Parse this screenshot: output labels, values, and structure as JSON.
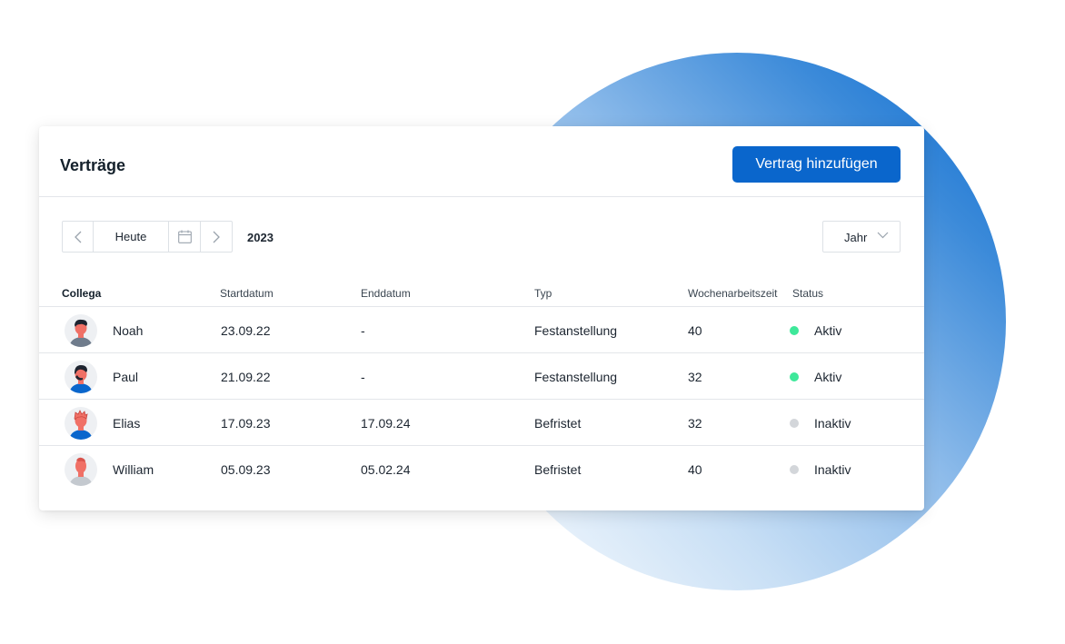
{
  "header": {
    "title": "Verträge",
    "add_button_label": "Vertrag hinzufügen"
  },
  "toolbar": {
    "prev_icon": "chevron-left-icon",
    "today_label": "Heute",
    "calendar_icon": "calendar-icon",
    "next_icon": "chevron-right-icon",
    "year": "2023",
    "period_value": "Jahr",
    "period_icon": "chevron-down-icon"
  },
  "table": {
    "columns": [
      "Collega",
      "Startdatum",
      "Enddatum",
      "Typ",
      "Wochenarbeitszeit",
      "Status"
    ],
    "rows": [
      {
        "name": "Noah",
        "start": "23.09.22",
        "end": "-",
        "type": "Festanstellung",
        "hours": "40",
        "status": "Aktiv",
        "status_color": "#3ee89a"
      },
      {
        "name": "Paul",
        "start": "21.09.22",
        "end": "-",
        "type": "Festanstellung",
        "hours": "32",
        "status": "Aktiv",
        "status_color": "#3ee89a"
      },
      {
        "name": "Elias",
        "start": "17.09.23",
        "end": "17.09.24",
        "type": "Befristet",
        "hours": "32",
        "status": "Inaktiv",
        "status_color": "#d3d6da"
      },
      {
        "name": "William",
        "start": "05.09.23",
        "end": "05.02.24",
        "type": "Befristet",
        "hours": "40",
        "status": "Inaktiv",
        "status_color": "#d3d6da"
      }
    ]
  },
  "colors": {
    "accent": "#0a66cc",
    "active": "#3ee89a",
    "inactive": "#d3d6da"
  }
}
